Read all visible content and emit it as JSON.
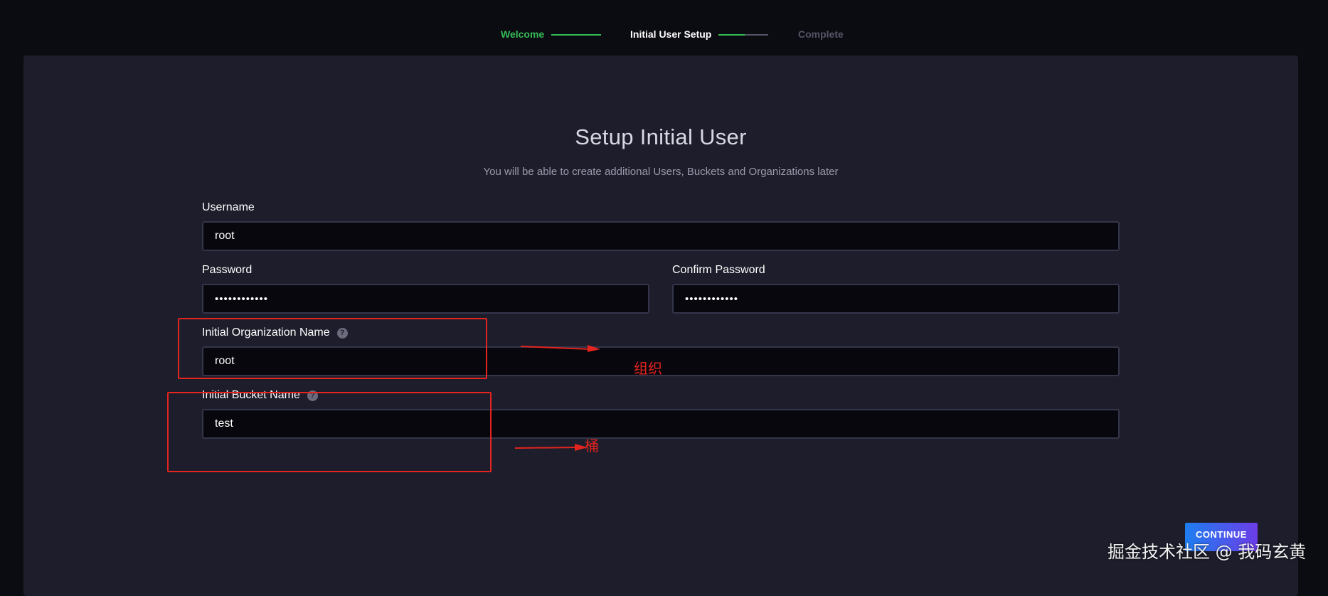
{
  "stepper": {
    "steps": [
      {
        "label": "Welcome",
        "state": "done"
      },
      {
        "label": "Initial User Setup",
        "state": "current"
      },
      {
        "label": "Complete",
        "state": "pending"
      }
    ],
    "colors": {
      "done": "#34bb55",
      "current": "#ffffff",
      "pending": "#545667"
    }
  },
  "form": {
    "title": "Setup Initial User",
    "subtitle": "You will be able to create additional Users, Buckets and Organizations later",
    "username": {
      "label": "Username",
      "value": "root"
    },
    "password": {
      "label": "Password",
      "value": "••••••••••••"
    },
    "confirm_password": {
      "label": "Confirm Password",
      "value": "••••••••••••"
    },
    "org_name": {
      "label": "Initial Organization Name",
      "value": "root"
    },
    "bucket_name": {
      "label": "Initial Bucket Name",
      "value": "test"
    },
    "help_glyph": "?",
    "continue_label": "CONTINUE"
  },
  "annotations": {
    "org_note": "组织",
    "bucket_note": "桶",
    "color": "#e3241f"
  },
  "watermark": "掘金技术社区 @ 我码玄黄"
}
